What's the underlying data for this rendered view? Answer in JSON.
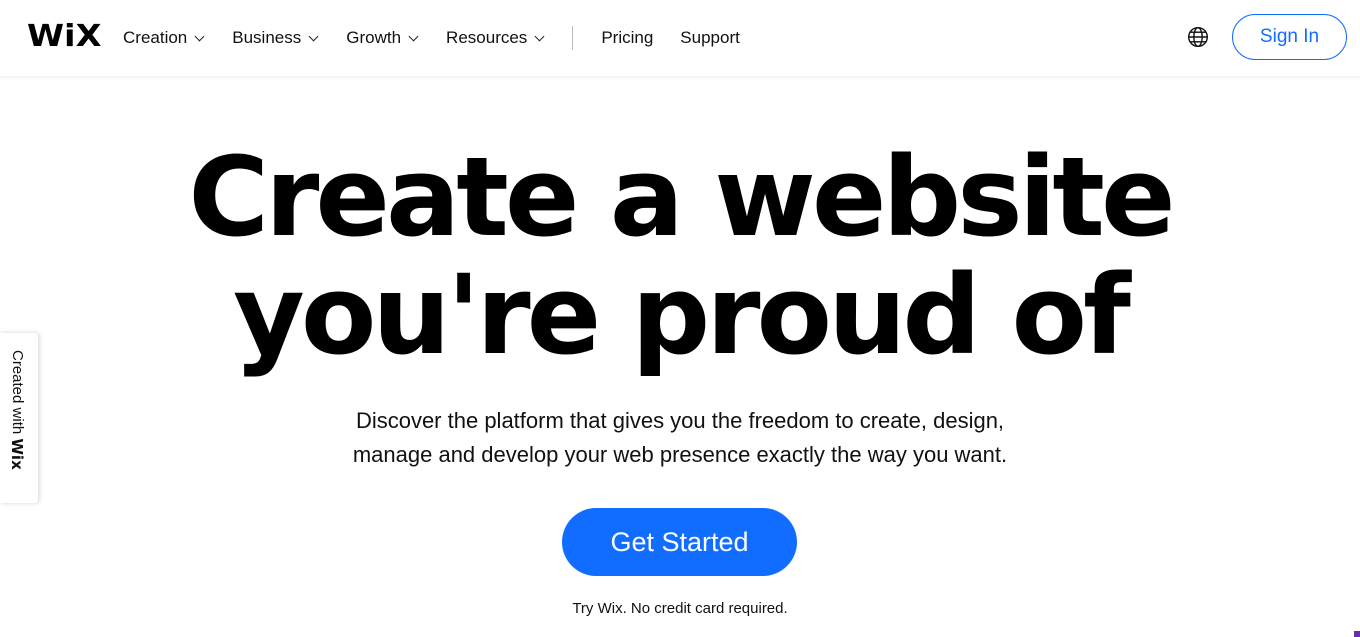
{
  "header": {
    "logo": "WiX",
    "nav": {
      "creation": "Creation",
      "business": "Business",
      "growth": "Growth",
      "resources": "Resources",
      "pricing": "Pricing",
      "support": "Support"
    },
    "globe_icon": "globe-icon",
    "sign_in": "Sign In"
  },
  "side_badge": {
    "prefix": "Created with",
    "brand": "Wix"
  },
  "hero": {
    "title_line1": "Create a website",
    "title_line2": "you're proud of",
    "subtitle_line1": "Discover the platform that gives you the freedom to create, design,",
    "subtitle_line2": "manage and develop your web presence exactly the way you want.",
    "cta": "Get Started",
    "note": "Try Wix. No credit card required."
  },
  "colors": {
    "accent": "#116dff",
    "text": "#000000",
    "background": "#ffffff"
  }
}
